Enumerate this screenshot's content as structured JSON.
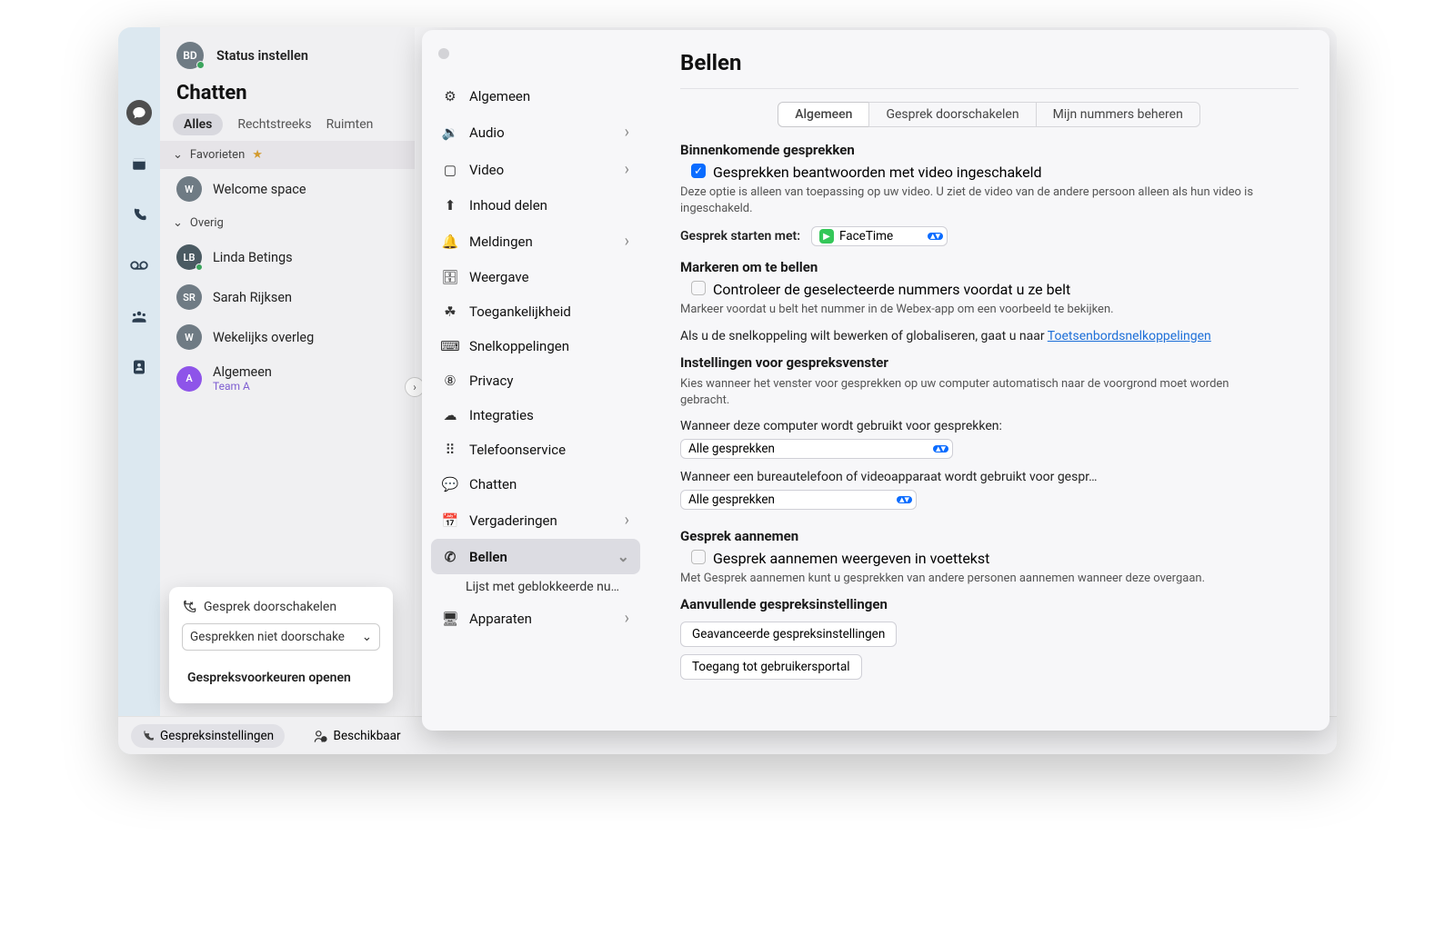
{
  "topbar": {
    "avatar_initials": "BD",
    "status_label": "Status instellen"
  },
  "sidebar": {
    "title": "Chatten",
    "filters": {
      "all": "Alles",
      "direct": "Rechtstreeks",
      "rooms": "Ruimten"
    },
    "sections": {
      "favourites_label": "Favorieten",
      "other_label": "Overig"
    },
    "items": [
      {
        "initials": "W",
        "name": "Welcome space",
        "avatar": "grey"
      },
      {
        "initials": "LB",
        "name": "Linda Betings",
        "avatar": "dk",
        "presence": true
      },
      {
        "initials": "SR",
        "name": "Sarah Rijksen",
        "avatar": "grey"
      },
      {
        "initials": "W",
        "name": "Wekelijks overleg",
        "avatar": "grey"
      },
      {
        "initials": "A",
        "name": "Algemeen",
        "sub": "Team A",
        "avatar": "purple"
      }
    ]
  },
  "forward_popup": {
    "title": "Gesprek doorschakelen",
    "select_value": "Gesprekken niet doorschake",
    "open_prefs": "Gespreksvoorkeuren openen"
  },
  "footer": {
    "call_settings": "Gespreksinstellingen",
    "presence": "Beschikbaar"
  },
  "settings_nav": [
    {
      "label": "Algemeen",
      "icon": "gear"
    },
    {
      "label": "Audio",
      "icon": "sound",
      "arrow": "r"
    },
    {
      "label": "Video",
      "icon": "video",
      "arrow": "r"
    },
    {
      "label": "Inhoud delen",
      "icon": "share"
    },
    {
      "label": "Meldingen",
      "icon": "bell",
      "arrow": "r"
    },
    {
      "label": "Weergave",
      "icon": "appear"
    },
    {
      "label": "Toegankelijkheid",
      "icon": "person"
    },
    {
      "label": "Snelkoppelingen",
      "icon": "keys"
    },
    {
      "label": "Privacy",
      "icon": "priv"
    },
    {
      "label": "Integraties",
      "icon": "cloud"
    },
    {
      "label": "Telefoonservice",
      "icon": "dial"
    },
    {
      "label": "Chatten",
      "icon": "chat"
    },
    {
      "label": "Vergaderingen",
      "icon": "cal",
      "arrow": "r"
    },
    {
      "label": "Bellen",
      "icon": "phone",
      "arrow": "d",
      "selected": true
    },
    {
      "label": "Apparaten",
      "icon": "dev",
      "arrow": "r"
    }
  ],
  "settings_nav_sub": "Lijst met geblokkeerde num…",
  "calling": {
    "title": "Bellen",
    "seg": {
      "a": "Algemeen",
      "b": "Gesprek doorschakelen",
      "c": "Mijn nummers beheren"
    },
    "incoming_h": "Binnenkomende gesprekken",
    "ans_video": "Gesprekken beantwoorden met video ingeschakeld",
    "ans_video_help": "Deze optie is alleen van toepassing op uw video. U ziet de video van de andere persoon alleen als hun video is ingeschakeld.",
    "start_with_label": "Gesprek starten met:",
    "start_with_value": "FaceTime",
    "mark_h": "Markeren om te bellen",
    "mark_check": "Controleer de geselecteerde nummers voordat u ze belt",
    "mark_help": "Markeer voordat u belt het nummer in de Webex-app om een voorbeeld te bekijken.",
    "mark_shortcut_pre": "Als u de snelkoppeling wilt bewerken of globaliseren, gaat u naar ",
    "mark_shortcut_link": "Toetsenbordsnelkoppelingen",
    "window_h": "Instellingen voor gespreksvenster",
    "window_help": "Kies wanneer het venster voor gesprekken op uw computer automatisch naar de voorgrond moet worden gebracht.",
    "when_computer": "Wanneer deze computer wordt gebruikt voor gesprekken:",
    "when_deskphone": "Wanneer een bureautelefoon of videoapparaat wordt gebruikt voor gespr…",
    "select_all": "Alle gesprekken",
    "pickup_h": "Gesprek aannemen",
    "pickup_check": "Gesprek aannemen weergeven in voettekst",
    "pickup_help": "Met Gesprek aannemen kunt u gesprekken van andere personen aannemen wanneer deze overgaan.",
    "extra_h": "Aanvullende gespreksinstellingen",
    "btn_adv": "Geavanceerde gespreksinstellingen",
    "btn_portal": "Toegang tot gebruikersportal"
  }
}
